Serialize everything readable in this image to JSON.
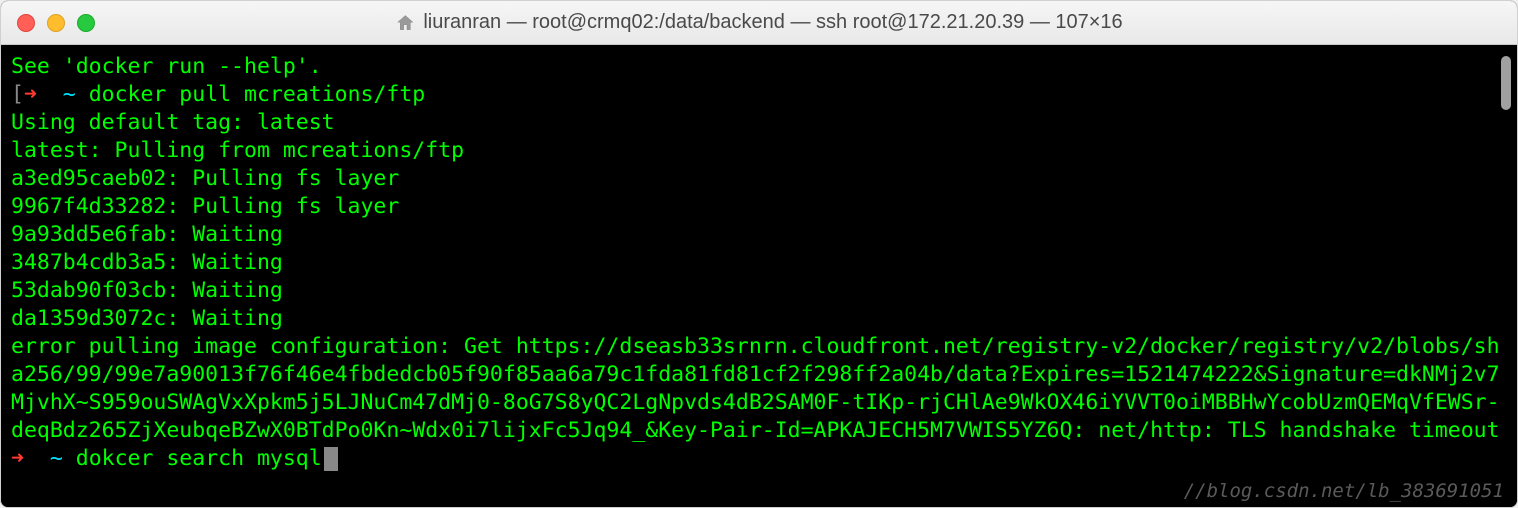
{
  "titlebar": {
    "title": "liuranran — root@crmq02:/data/backend — ssh root@172.21.20.39 — 107×16"
  },
  "terminal": {
    "lines": [
      {
        "type": "plain",
        "text": "See 'docker run --help'."
      },
      {
        "type": "prompt-open",
        "arrow": "➜",
        "tilde": "~",
        "cmd": "docker pull mcreations/ftp"
      },
      {
        "type": "plain",
        "text": "Using default tag: latest"
      },
      {
        "type": "plain",
        "text": "latest: Pulling from mcreations/ftp"
      },
      {
        "type": "plain",
        "text": "a3ed95caeb02: Pulling fs layer"
      },
      {
        "type": "plain",
        "text": "9967f4d33282: Pulling fs layer"
      },
      {
        "type": "plain",
        "text": "9a93dd5e6fab: Waiting"
      },
      {
        "type": "plain",
        "text": "3487b4cdb3a5: Waiting"
      },
      {
        "type": "plain",
        "text": "53dab90f03cb: Waiting"
      },
      {
        "type": "plain",
        "text": "da1359d3072c: Waiting"
      },
      {
        "type": "plain",
        "text": "error pulling image configuration: Get https://dseasb33srnrn.cloudfront.net/registry-v2/docker/registry/v2/blobs/sha256/99/99e7a90013f76f46e4fbdedcb05f90f85aa6a79c1fda81fd81cf2f298ff2a04b/data?Expires=1521474222&Signature=dkNMj2v7MjvhX~S959ouSWAgVxXpkm5j5LJNuCm47dMj0-8oG7S8yQC2LgNpvds4dB2SAM0F-tIKp-rjCHlAe9WkOX46iYVVT0oiMBBHwYcobUzmQEMqVfEWSr-deqBdz265ZjXeubqeBZwX0BTdPo0Kn~Wdx0i7lijxFc5Jq94_&Key-Pair-Id=APKAJECH5M7VWIS5YZ6Q: net/http: TLS handshake timeout"
      },
      {
        "type": "prompt",
        "arrow": "➜",
        "tilde": "~",
        "cmd": "dokcer search mysql"
      }
    ]
  },
  "watermark": "//blog.csdn.net/lb_383691051"
}
